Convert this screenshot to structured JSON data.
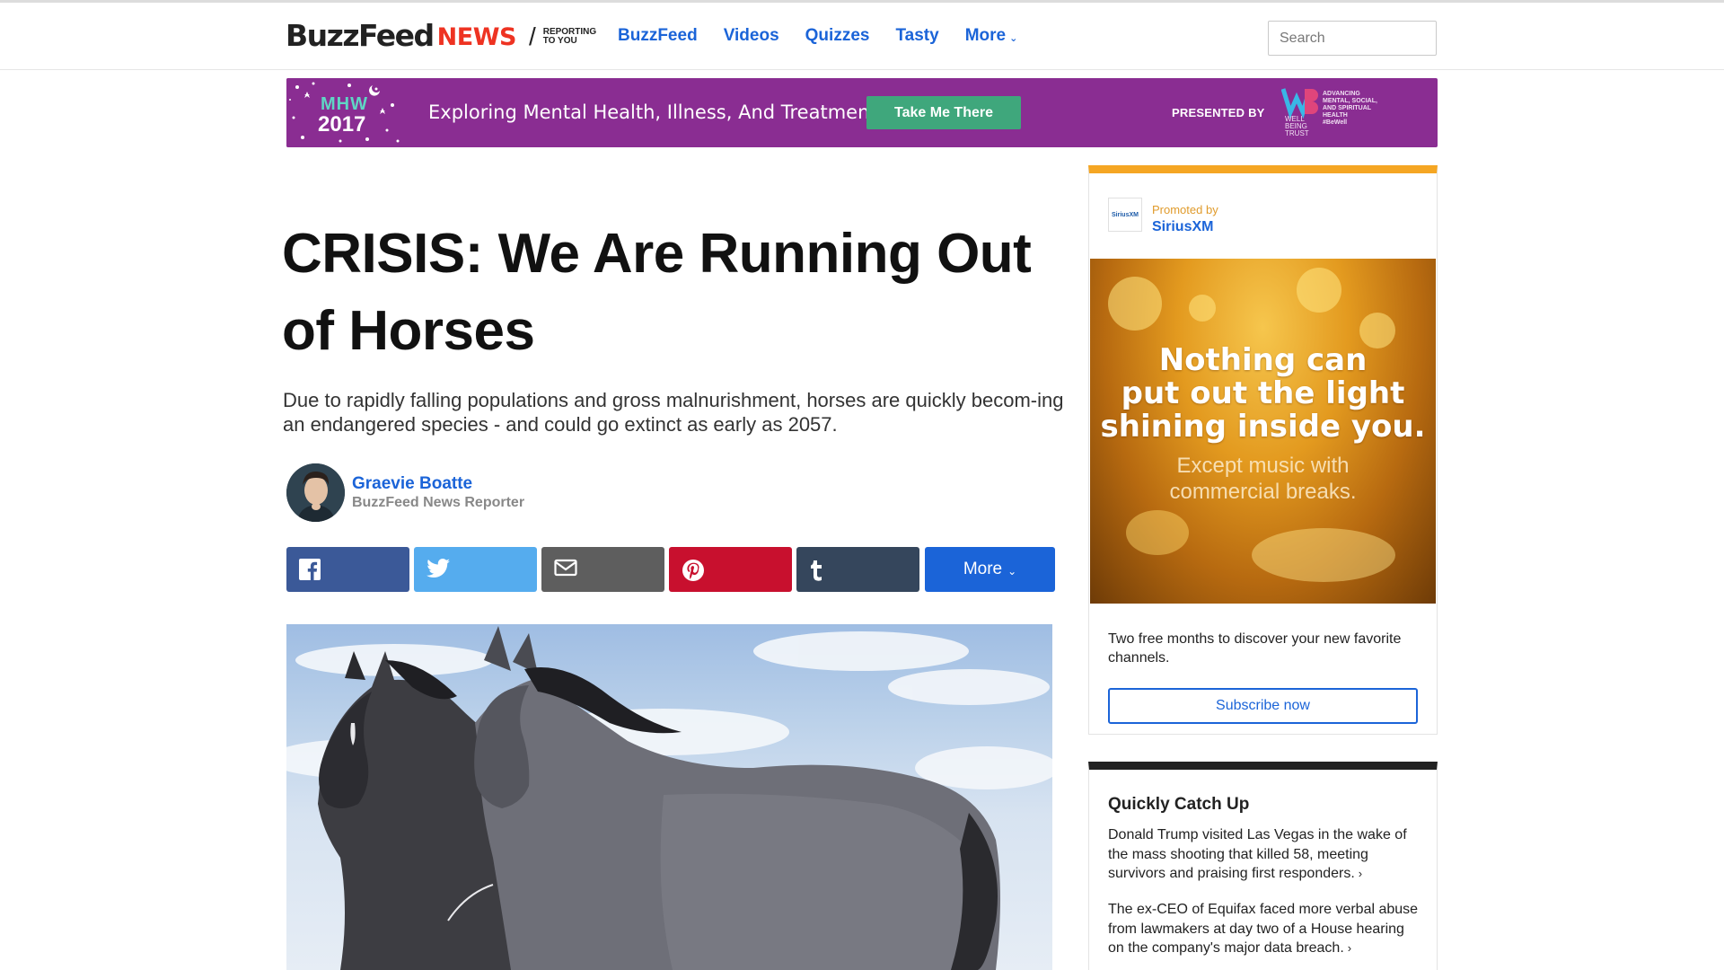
{
  "header": {
    "logo": {
      "buzz": "BuzzFeed",
      "news": "NEWS",
      "slash": "/",
      "tagline_1": "REPORTING",
      "tagline_2": "TO YOU"
    },
    "nav": [
      {
        "label": "BuzzFeed"
      },
      {
        "label": "Videos"
      },
      {
        "label": "Quizzes"
      },
      {
        "label": "Tasty"
      },
      {
        "label": "More"
      }
    ],
    "search_placeholder": "Search"
  },
  "banner": {
    "badge_top": "MHW",
    "badge_year": "2017",
    "text": "Exploring Mental Health, Illness, And Treatment",
    "button": "Take Me There",
    "presented_by": "PRESENTED BY",
    "sponsor_lines": [
      "ADVANCING",
      "MENTAL, SOCIAL,",
      "AND SPIRITUAL",
      "HEALTH",
      "#BeWell"
    ],
    "sponsor_mark": [
      "WELL",
      "BEING",
      "TRUST"
    ],
    "colors": {
      "background": "#8a2d92",
      "button": "#3fa77c",
      "badge_accent": "#5fd6c4"
    }
  },
  "article": {
    "title": "CRISIS: We Are Running Out of Horses",
    "dek": "Due to rapidly falling populations and gross malnurishment, horses are quickly becom-ing an endangered species - and could go extinct as early as 2057.",
    "author": {
      "name": "Graevie Boatte",
      "role": "BuzzFeed News Reporter"
    },
    "share": [
      {
        "network": "facebook",
        "icon": "facebook-icon",
        "color": "#3b5998"
      },
      {
        "network": "twitter",
        "icon": "twitter-icon",
        "color": "#55acee"
      },
      {
        "network": "email",
        "icon": "email-icon",
        "color": "#5e5e5e"
      },
      {
        "network": "pinterest",
        "icon": "pinterest-icon",
        "color": "#c8102e"
      },
      {
        "network": "tumblr",
        "icon": "tumblr-icon",
        "color": "#35465c"
      }
    ],
    "share_more_label": "More"
  },
  "promo": {
    "logo_text": "SiriusXM",
    "promoted_by": "Promoted by",
    "sponsor": "SiriusXM",
    "headline_lines": [
      "Nothing can",
      "put out the light",
      "shining inside you."
    ],
    "sub_lines": [
      "Except music with",
      "commercial breaks."
    ],
    "copy": "Two free months to discover your new favorite channels.",
    "button": "Subscribe now",
    "accent": "#f5a623"
  },
  "catchup": {
    "title": "Quickly Catch Up",
    "items": [
      {
        "text": "Donald Trump visited Las Vegas in the wake of the mass shooting that killed 58, meeting survivors and praising first responders."
      },
      {
        "text": "The ex-CEO of Equifax faced more verbal abuse from lawmakers at day two of a House hearing on the company's major data breach."
      }
    ]
  }
}
